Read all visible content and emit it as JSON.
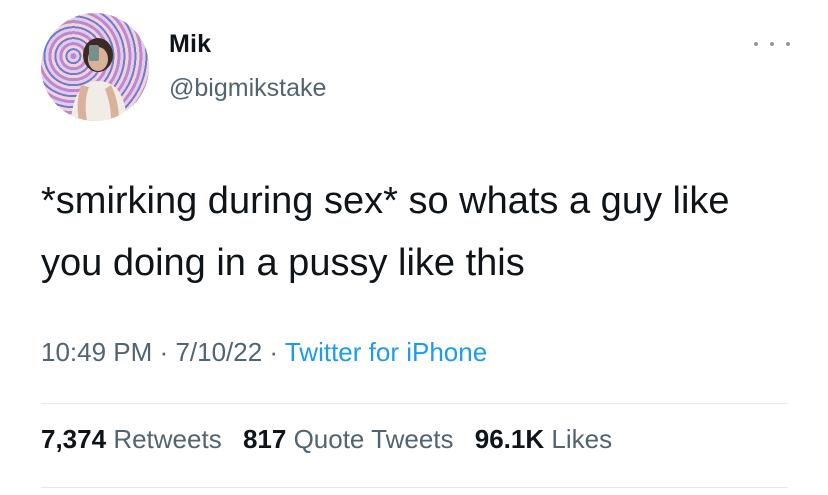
{
  "tweet": {
    "author_name": "Mik",
    "author_handle": "@bigmikstake",
    "text": "*smirking during sex* so whats a guy like you doing in a pussy like this",
    "time": "10:49 PM",
    "date": "7/10/22",
    "source": "Twitter for iPhone",
    "separator": "·"
  },
  "stats": {
    "retweets_count": "7,374",
    "retweets_label": "Retweets",
    "quotes_count": "817",
    "quotes_label": "Quote Tweets",
    "likes_count": "96.1K",
    "likes_label": "Likes"
  },
  "icons": {
    "more": "more-horizontal-icon"
  },
  "colors": {
    "text": "#0f1419",
    "secondary": "#536471",
    "link": "#1d9bf0",
    "divider": "#e6e9ec"
  }
}
